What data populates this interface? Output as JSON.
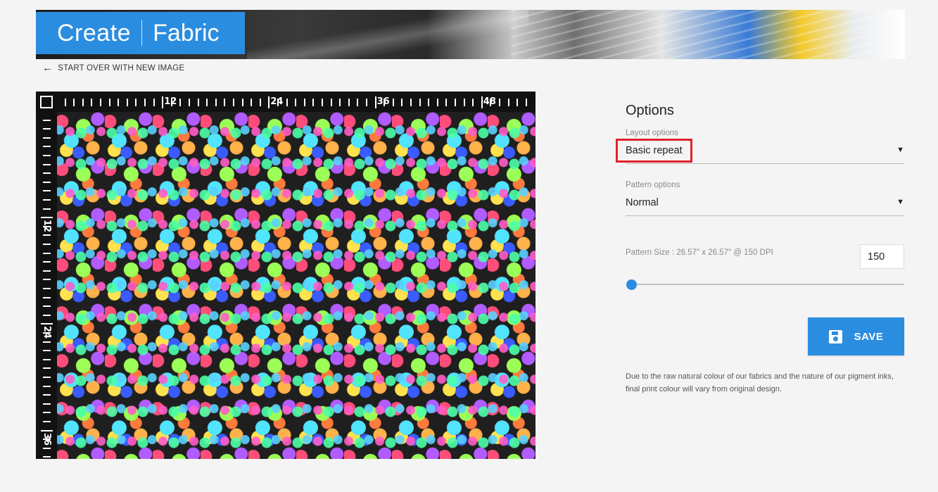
{
  "header": {
    "logo_create": "Create",
    "logo_fabric": "Fabric"
  },
  "nav": {
    "back_label": "START OVER WITH NEW IMAGE"
  },
  "preview": {
    "top_ruler_labels": [
      "12",
      "24",
      "36",
      "48"
    ],
    "left_ruler_labels": [
      "12",
      "24",
      "36"
    ]
  },
  "options": {
    "title": "Options",
    "layout_label": "Layout options",
    "layout_value": "Basic repeat",
    "pattern_label": "Pattern options",
    "pattern_value": "Normal",
    "size_label": "Pattern Size : 26.57\" x 26.57\" @ 150 DPI",
    "dpi_value": "150",
    "slider_fraction": 0.0
  },
  "actions": {
    "save_label": "SAVE"
  },
  "disclaimer": "Due to the raw natural colour of our fabrics and the nature of our pigment inks, final print colour will vary from original design.",
  "colors": {
    "accent": "#2b8de0",
    "highlight": "#e0232b",
    "background": "#f4f4f4"
  },
  "icons": {
    "back": "arrow-left-icon",
    "save": "floppy-disk-icon",
    "dropdown": "caret-down-icon"
  }
}
